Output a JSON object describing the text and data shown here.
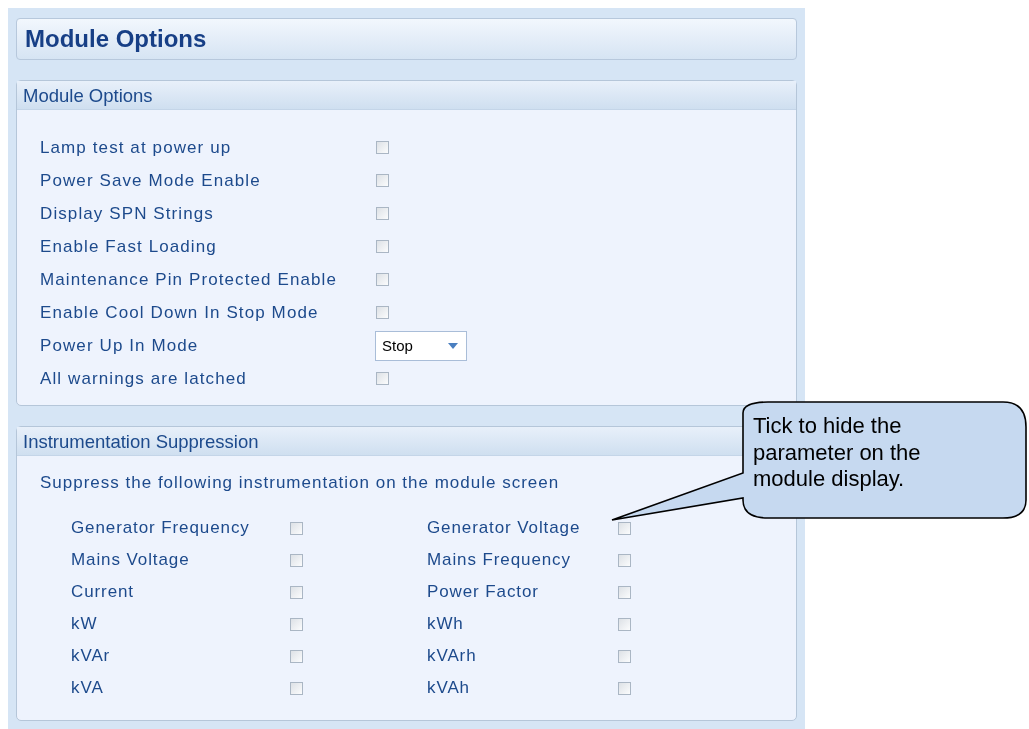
{
  "page_title": "Module Options",
  "module_options": {
    "title": "Module Options",
    "rows": [
      {
        "kind": "checkbox",
        "label": "Lamp test at power up",
        "checked": false
      },
      {
        "kind": "checkbox",
        "label": "Power Save Mode Enable",
        "checked": false
      },
      {
        "kind": "checkbox",
        "label": "Display SPN Strings",
        "checked": false
      },
      {
        "kind": "checkbox",
        "label": "Enable Fast Loading",
        "checked": false
      },
      {
        "kind": "checkbox",
        "label": "Maintenance Pin Protected Enable",
        "checked": false
      },
      {
        "kind": "checkbox",
        "label": "Enable Cool Down In Stop Mode",
        "checked": false
      },
      {
        "kind": "dropdown",
        "label": "Power Up In Mode",
        "value": "Stop"
      },
      {
        "kind": "checkbox",
        "label": "All warnings are latched",
        "checked": false
      }
    ]
  },
  "instrumentation_suppression": {
    "title": "Instrumentation Suppression",
    "description": "Suppress the following instrumentation on the module screen",
    "left_column": [
      {
        "label": "Generator Frequency",
        "checked": false
      },
      {
        "label": "Mains Voltage",
        "checked": false
      },
      {
        "label": "Current",
        "checked": false
      },
      {
        "label": "kW",
        "checked": false
      },
      {
        "label": "kVAr",
        "checked": false
      },
      {
        "label": "kVA",
        "checked": false
      }
    ],
    "right_column": [
      {
        "label": "Generator Voltage",
        "checked": false
      },
      {
        "label": "Mains Frequency",
        "checked": false
      },
      {
        "label": "Power Factor",
        "checked": false
      },
      {
        "label": "kWh",
        "checked": false
      },
      {
        "label": "kVArh",
        "checked": false
      },
      {
        "label": "kVAh",
        "checked": false
      }
    ]
  },
  "callout": {
    "text": "Tick to hide the parameter on the module display."
  }
}
